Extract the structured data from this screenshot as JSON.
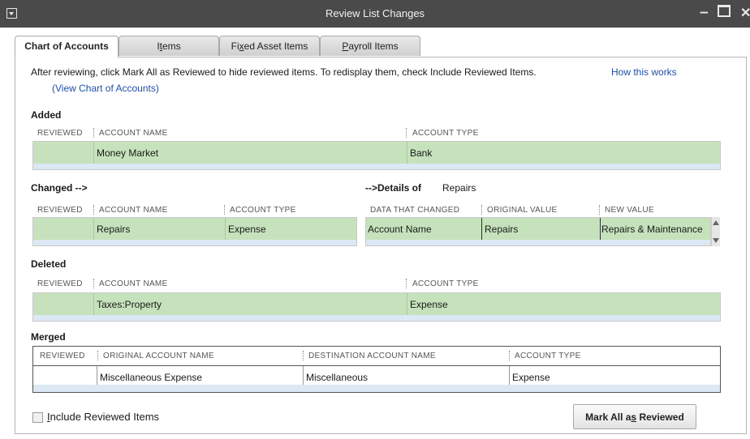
{
  "window": {
    "title": "Review List Changes"
  },
  "tabs": [
    {
      "label": "Chart of Accounts",
      "active": true
    },
    {
      "label": "Items",
      "underline": "t"
    },
    {
      "label": "Fixed Asset Items",
      "underline": "x"
    },
    {
      "label": "Payroll Items",
      "underline": "P"
    }
  ],
  "info": {
    "text": "After reviewing, click Mark All as Reviewed to hide reviewed items. To redisplay them, check Include Reviewed Items.",
    "view_link": "(View Chart of Accounts)",
    "how_link": "How this works"
  },
  "added": {
    "label": "Added",
    "headers": [
      "REVIEWED",
      "ACCOUNT NAME",
      "ACCOUNT TYPE"
    ],
    "rows": [
      {
        "reviewed": "",
        "account_name": "Money Market",
        "account_type": "Bank"
      }
    ]
  },
  "changed": {
    "label": "Changed  -->",
    "headers": [
      "REVIEWED",
      "ACCOUNT NAME",
      "ACCOUNT TYPE"
    ],
    "rows": [
      {
        "reviewed": "",
        "account_name": "Repairs",
        "account_type": "Expense"
      }
    ]
  },
  "details": {
    "label": "-->Details of",
    "value": "Repairs",
    "headers": [
      "DATA THAT CHANGED",
      "ORIGINAL VALUE",
      "NEW VALUE"
    ],
    "rows": [
      {
        "data": "Account Name",
        "original": "Repairs",
        "new": "Repairs & Maintenance"
      }
    ]
  },
  "deleted": {
    "label": "Deleted",
    "headers": [
      "REVIEWED",
      "ACCOUNT NAME",
      "ACCOUNT TYPE"
    ],
    "rows": [
      {
        "reviewed": "",
        "account_name": "Taxes:Property",
        "account_type": "Expense"
      }
    ]
  },
  "merged": {
    "label": "Merged",
    "headers": [
      "REVIEWED",
      "ORIGINAL ACCOUNT NAME",
      "DESTINATION ACCOUNT NAME",
      "ACCOUNT TYPE"
    ],
    "rows": [
      {
        "reviewed": "",
        "original": "Miscellaneous  Expense",
        "destination": "Miscellaneous",
        "account_type": "Expense"
      }
    ]
  },
  "footer": {
    "include_reviewed": {
      "label": "Include Reviewed Items",
      "checked": false
    },
    "mark_all_button": "Mark All as Reviewed"
  },
  "colors": {
    "titlebar": "#4a4a4a",
    "row_green": "#c6e2bc",
    "row_strip": "#dce8f3",
    "link": "#1f4fa6"
  }
}
